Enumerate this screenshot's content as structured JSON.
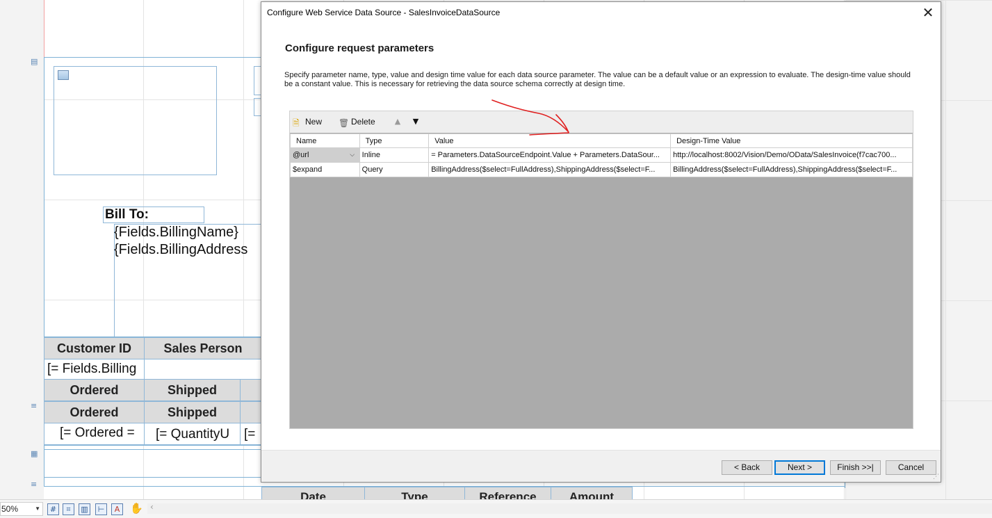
{
  "dialog": {
    "title": "Configure Web Service Data Source - SalesInvoiceDataSource",
    "close_glyph": "✕",
    "heading": "Configure request parameters",
    "description": "Specify parameter name, type, value and design time value for each data source parameter. The value can be a default value or an expression to evaluate. The design-time value should be a constant value. This is necessary for retrieving the data source schema correctly at design time.",
    "toolbar": {
      "new_label": "New",
      "delete_label": "Delete",
      "new_icon": "new-document-icon",
      "delete_icon": "trash-icon",
      "move_up_icon": "arrow-up-icon",
      "move_down_icon": "arrow-down-icon"
    },
    "columns": [
      "Name",
      "Type",
      "Value",
      "Design-Time Value"
    ],
    "rows": [
      {
        "name": "@url",
        "type": "Inline",
        "value": "= Parameters.DataSourceEndpoint.Value + Parameters.DataSour...",
        "design_time_value": "http://localhost:8002/Vision/Demo/OData/SalesInvoice(f7cac700..."
      },
      {
        "name": "$expand",
        "type": "Query",
        "value": "BillingAddress($select=FullAddress),ShippingAddress($select=F...",
        "design_time_value": "BillingAddress($select=FullAddress),ShippingAddress($select=F..."
      }
    ],
    "buttons": {
      "back": "< Back",
      "next": "Next >",
      "finish": "Finish >>|",
      "cancel": "Cancel"
    }
  },
  "designer": {
    "bill_to_label": "Bill To:",
    "billing_name_field": "{Fields.BillingName}",
    "billing_address_field": "{Fields.BillingAddress",
    "table_header": [
      "Customer ID",
      "Sales Person"
    ],
    "table_value": "[= Fields.Billing",
    "lines_header_1": [
      "Ordered",
      "Shipped"
    ],
    "lines_header_2": [
      "Ordered",
      "Shipped"
    ],
    "lines_values": [
      "[= Ordered =",
      "[= QuantityU",
      "[="
    ],
    "bottom_table_header": [
      "Date",
      "Type",
      "Reference",
      "Amount"
    ]
  },
  "statusbar": {
    "zoom": "50%",
    "icons": [
      "grid-icon",
      "snap-icon",
      "ruler-icon",
      "guides-icon",
      "text-icon",
      "pan-hand-icon"
    ]
  },
  "colors": {
    "annotation_stroke": "#e02020",
    "primary_button_border": "#0078d7",
    "grid_empty_area": "#ababab"
  }
}
